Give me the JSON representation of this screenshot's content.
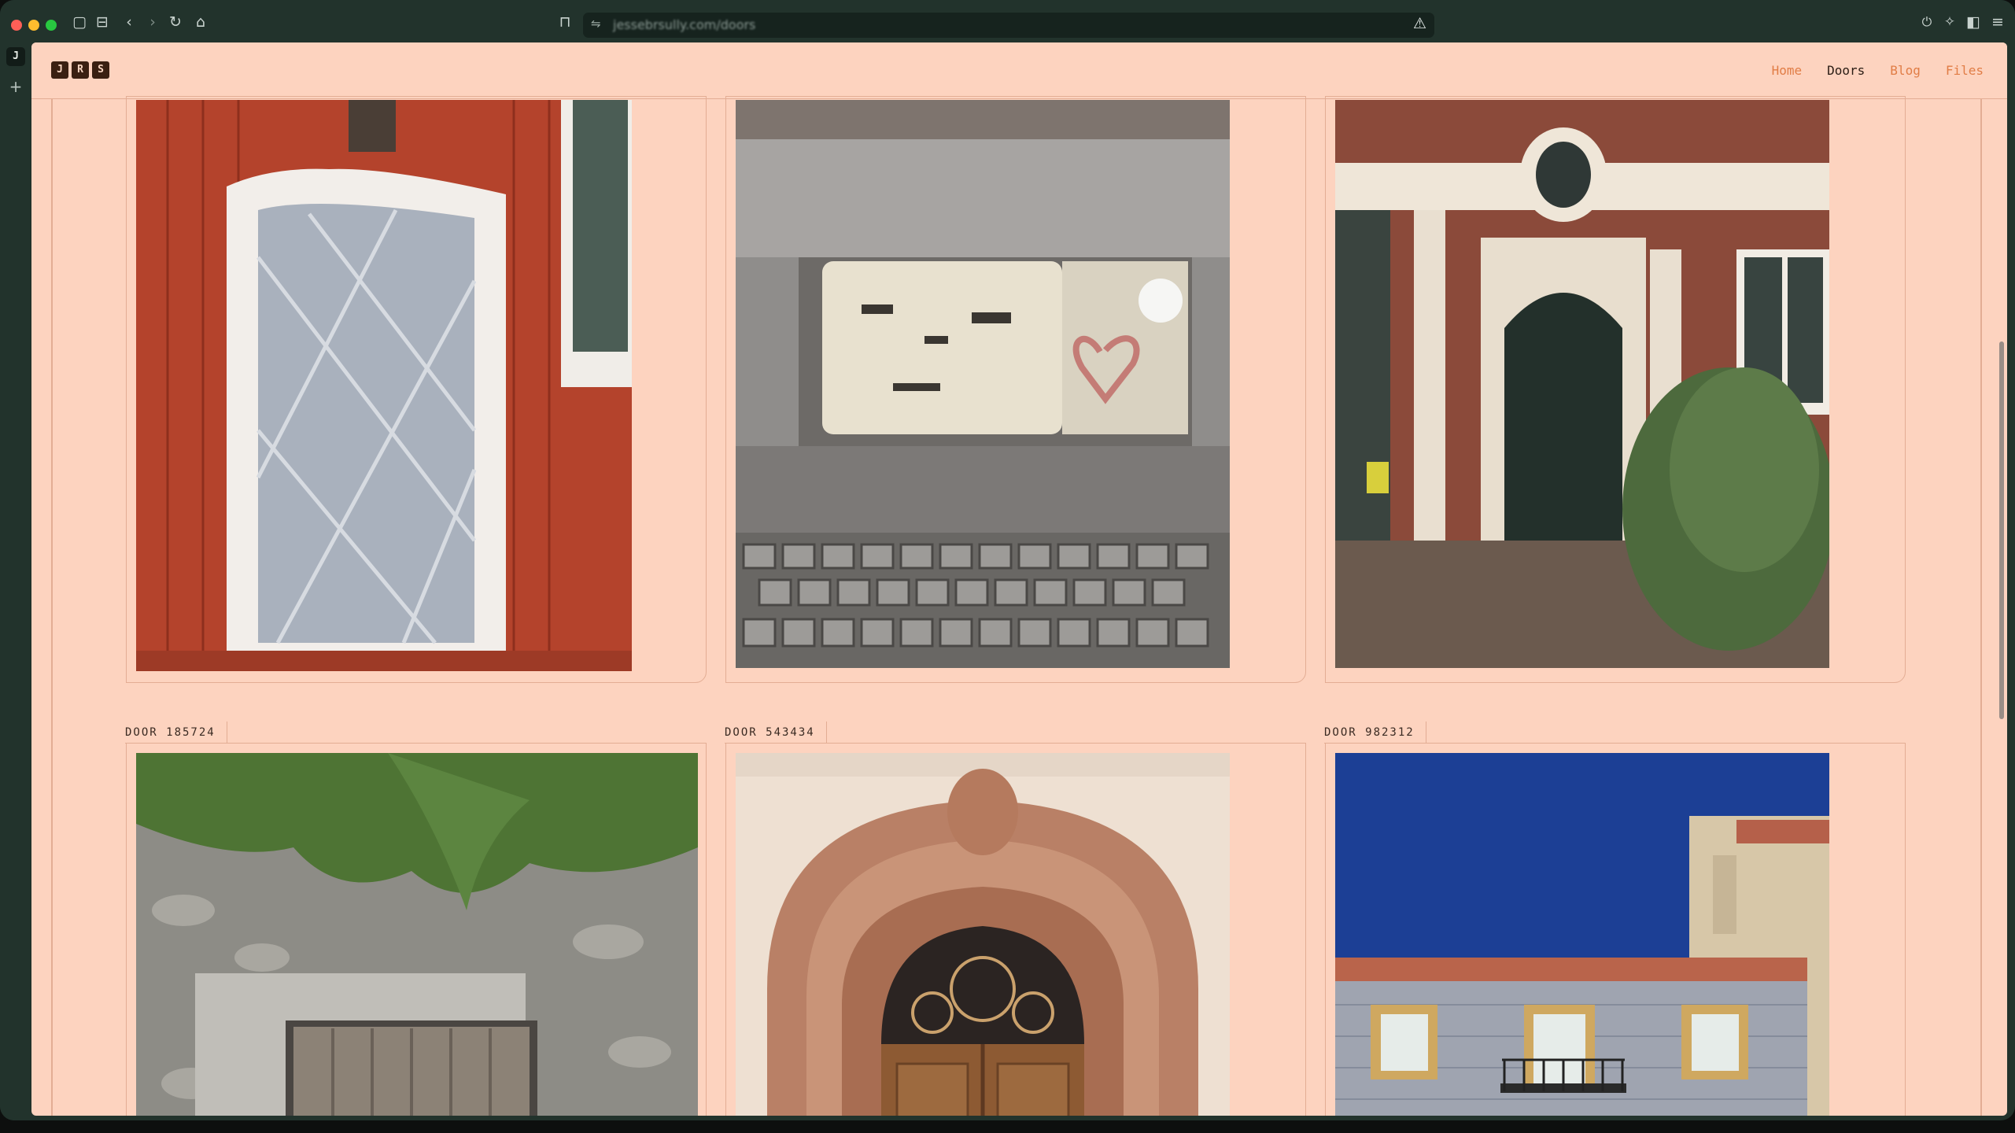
{
  "browser": {
    "url": "jessebrsully.com/doors",
    "space_badge": "J",
    "add_space": "+"
  },
  "site": {
    "logo": [
      "J",
      "R",
      "S"
    ],
    "nav": [
      {
        "label": "Home",
        "active": false
      },
      {
        "label": "Doors",
        "active": true
      },
      {
        "label": "Blog",
        "active": false
      },
      {
        "label": "Files",
        "active": false
      }
    ]
  },
  "doors": {
    "row1": [
      {
        "name": "red-wall-white-door"
      },
      {
        "name": "basement-hatch-heart"
      },
      {
        "name": "brick-arched-door"
      }
    ],
    "row2": [
      {
        "label": "DOOR 185724",
        "name": "stone-wall-wooden-door"
      },
      {
        "label": "DOOR 543434",
        "name": "sandstone-arch-door"
      },
      {
        "label": "DOOR 982312",
        "name": "tiled-facade-balcony"
      }
    ]
  },
  "colors": {
    "page_bg": "#fdd3bf",
    "border": "#e3ad94",
    "nav_link": "#e17d46",
    "nav_active": "#2a1c14"
  }
}
